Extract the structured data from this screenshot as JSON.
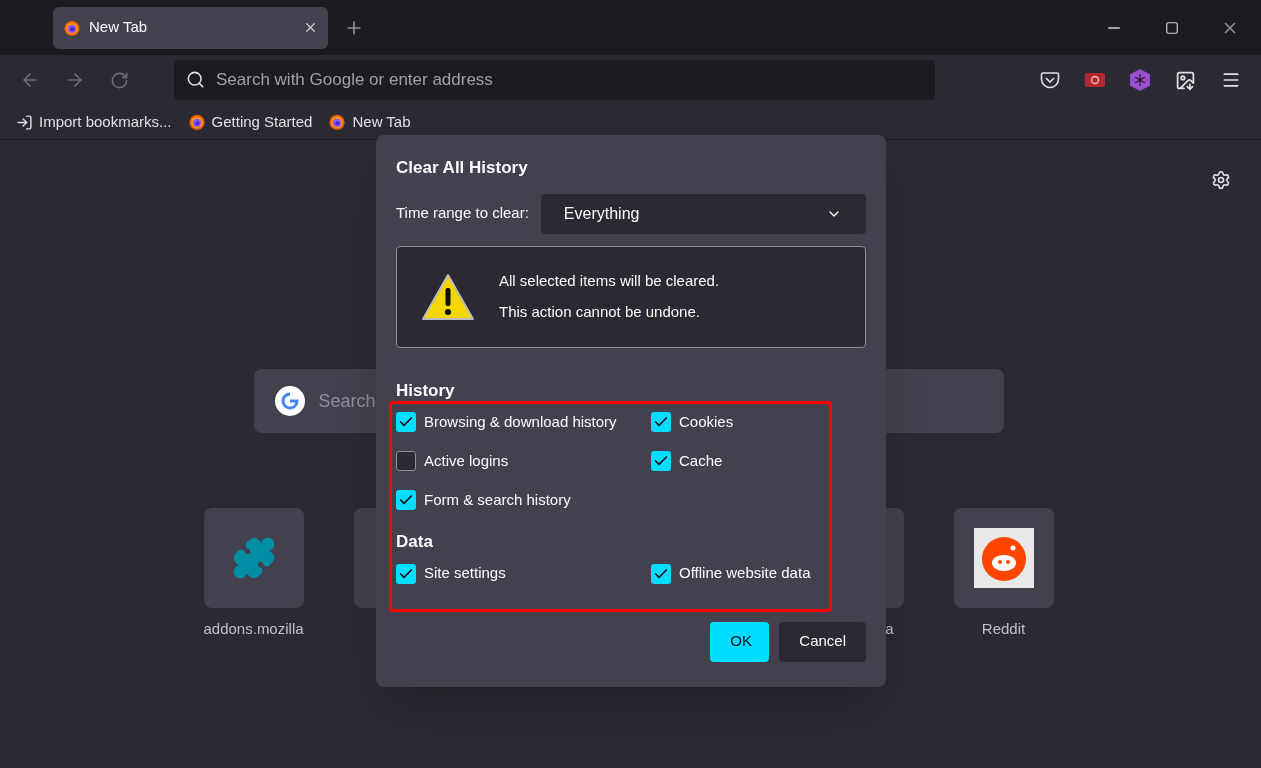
{
  "tabs": [
    {
      "label": "New Tab",
      "selected": true
    }
  ],
  "address_bar": {
    "placeholder": "Search with Google or enter address"
  },
  "bookmarks": [
    {
      "kind": "import",
      "label": "Import bookmarks..."
    },
    {
      "kind": "firefox",
      "label": "Getting Started"
    },
    {
      "kind": "firefox",
      "label": "New Tab"
    }
  ],
  "page": {
    "search": {
      "placeholder": "Search"
    },
    "top_sites": [
      {
        "kind": "puzzle",
        "label": "addons.mozilla"
      },
      {
        "kind": "blank"
      },
      {
        "kind": "blank",
        "label": "a"
      },
      {
        "kind": "reddit",
        "label": "Reddit"
      }
    ]
  },
  "dialog": {
    "title": "Clear All History",
    "time_range": {
      "label": "Time range to clear:",
      "value": "Everything"
    },
    "warning": [
      "All selected items will be cleared.",
      "This action cannot be undone."
    ],
    "sections": [
      {
        "title": "History",
        "options": [
          {
            "label": "Browsing & download history",
            "checked": true
          },
          {
            "label": "Cookies",
            "checked": true
          },
          {
            "label": "Active logins",
            "checked": false
          },
          {
            "label": "Cache",
            "checked": true
          },
          {
            "label": "Form & search history",
            "checked": true
          }
        ]
      },
      {
        "title": "Data",
        "options": [
          {
            "label": "Site settings",
            "checked": true
          },
          {
            "label": "Offline website data",
            "checked": true
          }
        ]
      }
    ],
    "buttons": [
      {
        "label": "OK",
        "kind": "primary"
      },
      {
        "label": "Cancel",
        "kind": "secondary"
      }
    ]
  }
}
